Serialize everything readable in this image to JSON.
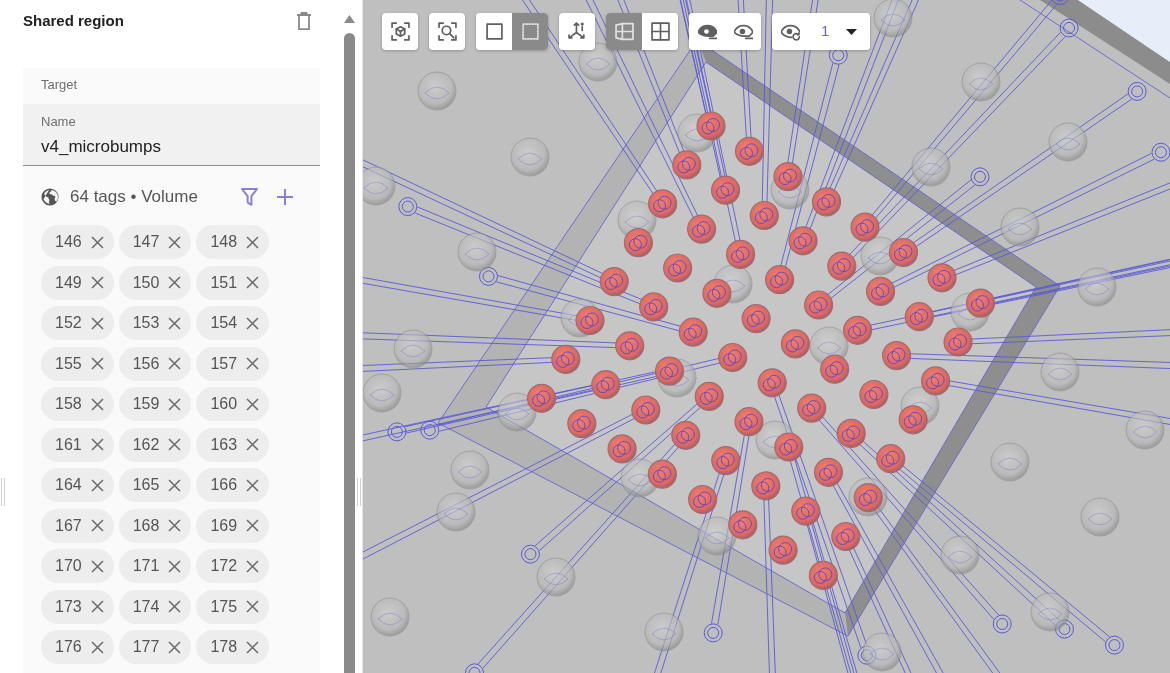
{
  "panel": {
    "title": "Shared region",
    "target_label": "Target",
    "name_field": {
      "label": "Name",
      "value": "v4_microbumps"
    },
    "tags_summary": "64 tags • Volume",
    "tags": [
      "146",
      "147",
      "148",
      "149",
      "150",
      "151",
      "152",
      "153",
      "154",
      "155",
      "156",
      "157",
      "158",
      "159",
      "160",
      "161",
      "162",
      "163",
      "164",
      "165",
      "166",
      "167",
      "168",
      "169",
      "170",
      "171",
      "172",
      "173",
      "174",
      "175",
      "176",
      "177",
      "178"
    ]
  },
  "toolbar": {
    "groups": [
      {
        "buttons": [
          {
            "kind": "focus-object"
          }
        ]
      },
      {
        "buttons": [
          {
            "kind": "zoom-fit"
          }
        ]
      },
      {
        "buttons": [
          {
            "kind": "box-select",
            "selected": false
          },
          {
            "kind": "box-select-dotted",
            "selected": true
          }
        ]
      },
      {
        "buttons": [
          {
            "kind": "axes"
          }
        ]
      },
      {
        "buttons": [
          {
            "kind": "perspective",
            "selected": true
          },
          {
            "kind": "grid",
            "selected": false
          }
        ]
      },
      {
        "buttons": [
          {
            "kind": "eye-filled"
          },
          {
            "kind": "eye-outline"
          }
        ]
      },
      {
        "buttons": [
          {
            "kind": "eye-refresh"
          }
        ],
        "select": {
          "value": "1"
        }
      }
    ]
  }
}
